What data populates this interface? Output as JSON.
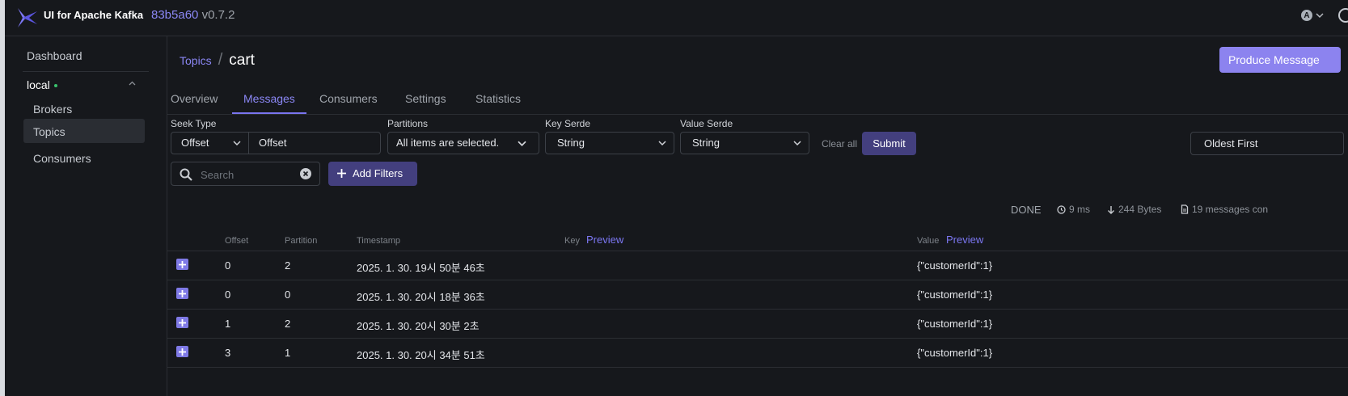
{
  "header": {
    "app_name": "UI for Apache Kafka",
    "version_hash": "83b5a60",
    "version": "v0.7.2",
    "avatar_letter": "A"
  },
  "sidebar": {
    "dashboard": "Dashboard",
    "cluster": "local",
    "items": [
      "Brokers",
      "Topics",
      "Consumers"
    ],
    "active_item": "Topics"
  },
  "breadcrumb": {
    "parent": "Topics",
    "separator": "/",
    "current": "cart"
  },
  "produce_button": "Produce Message",
  "tabs": [
    "Overview",
    "Messages",
    "Consumers",
    "Settings",
    "Statistics"
  ],
  "active_tab": "Messages",
  "filters": {
    "seek_type_label": "Seek Type",
    "seek_type_value": "Offset",
    "seek_input_value": "Offset",
    "partitions_label": "Partitions",
    "partitions_value": "All items are selected.",
    "key_serde_label": "Key Serde",
    "key_serde_value": "String",
    "value_serde_label": "Value Serde",
    "value_serde_value": "String",
    "clear_all": "Clear all",
    "submit": "Submit",
    "sort": "Oldest First",
    "search_placeholder": "Search",
    "add_filters": "Add Filters"
  },
  "stats": {
    "status": "DONE",
    "elapsed": "9 ms",
    "bytes": "244 Bytes",
    "messages": "19 messages con"
  },
  "table": {
    "columns": {
      "offset": "Offset",
      "partition": "Partition",
      "timestamp": "Timestamp",
      "key": "Key",
      "key_preview": "Preview",
      "value": "Value",
      "value_preview": "Preview"
    },
    "rows": [
      {
        "offset": "0",
        "partition": "2",
        "timestamp": "2025. 1. 30. 19시 50분 46초",
        "key": "",
        "value": "{\"customerId\":1}"
      },
      {
        "offset": "0",
        "partition": "0",
        "timestamp": "2025. 1. 30. 20시 18분 36초",
        "key": "",
        "value": "{\"customerId\":1}"
      },
      {
        "offset": "1",
        "partition": "2",
        "timestamp": "2025. 1. 30. 20시 30분 2초",
        "key": "",
        "value": "{\"customerId\":1}"
      },
      {
        "offset": "3",
        "partition": "1",
        "timestamp": "2025. 1. 30. 20시 34분 51초",
        "key": "",
        "value": "{\"customerId\":1}"
      }
    ]
  },
  "colors": {
    "accent": "#8b87f5",
    "button": "#433f7e",
    "background": "#16181c",
    "status_dot": "#39c16c"
  }
}
